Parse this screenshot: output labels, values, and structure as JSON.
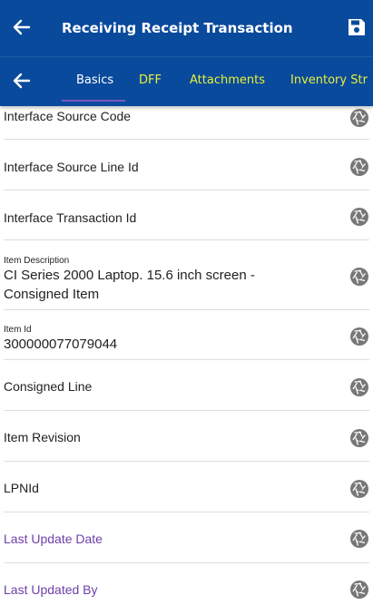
{
  "topbar": {
    "back_icon": "arrow-left-icon",
    "title": "Receiving Receipt Transaction ...",
    "save_icon": "save-icon"
  },
  "tabs": {
    "back_icon": "arrow-left-icon",
    "items": [
      {
        "label": "Basics",
        "active": true
      },
      {
        "label": "DFF",
        "active": false
      },
      {
        "label": "Attachments",
        "active": false
      },
      {
        "label": "Inventory Str",
        "active": false
      }
    ]
  },
  "fields": [
    {
      "label": "Interface Source Code",
      "action_icon": "camera-shutter-icon"
    },
    {
      "label": "Interface Source Line Id",
      "action_icon": "camera-shutter-icon"
    },
    {
      "label": "Interface Transaction Id",
      "action_icon": "camera-shutter-icon"
    },
    {
      "label": "Item Description",
      "value": "CI Series 2000 Laptop. 15.6 inch screen - Consigned Item",
      "action_icon": "camera-shutter-icon"
    },
    {
      "label": "Item Id",
      "value": "300000077079044",
      "action_icon": "camera-shutter-icon"
    },
    {
      "label": "Consigned Line",
      "action_icon": "camera-shutter-icon"
    },
    {
      "label": "Item Revision",
      "action_icon": "camera-shutter-icon"
    },
    {
      "label": "LPNId",
      "action_icon": "camera-shutter-icon"
    },
    {
      "label": "Last Update Date",
      "action_icon": "camera-shutter-icon"
    },
    {
      "label": "Last Updated By",
      "action_icon": "camera-shutter-icon"
    }
  ],
  "colors": {
    "header_bg": "#0a4a9c",
    "active_tab": "#ffffff",
    "inactive_tab": "#e8ef3a",
    "tab_indicator": "#7e57c2",
    "readonly_label": "#6e3fa8"
  }
}
